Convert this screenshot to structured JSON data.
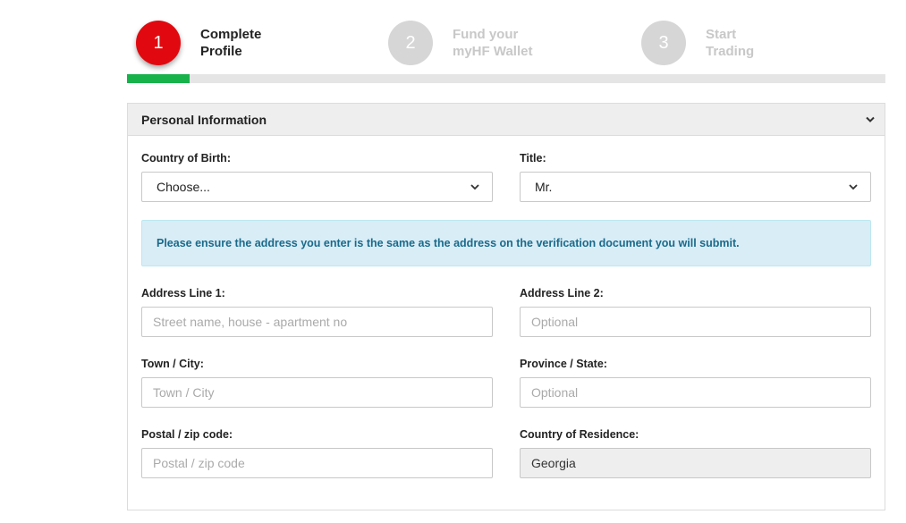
{
  "stepper": {
    "steps": [
      {
        "number": "1",
        "label": "Complete\nProfile",
        "state": "active"
      },
      {
        "number": "2",
        "label": "Fund your\nmyHF Wallet",
        "state": "inactive"
      },
      {
        "number": "3",
        "label": "Start\nTrading",
        "state": "inactive"
      }
    ],
    "progress_fraction": 0.083,
    "colors": {
      "active": "#e1090f",
      "inactive": "#d6d6d6",
      "progress": "#18b24b"
    }
  },
  "panel": {
    "title": "Personal Information",
    "icon": "chevron-down-icon",
    "alert_text": "Please ensure the address you enter is the same as the address on the verification document you will submit.",
    "fields": {
      "country_of_birth": {
        "label": "Country of Birth:",
        "value": "Choose..."
      },
      "title": {
        "label": "Title:",
        "value": "Mr."
      },
      "address_line_1": {
        "label": "Address Line 1:",
        "placeholder": "Street name, house - apartment no"
      },
      "address_line_2": {
        "label": "Address Line 2:",
        "placeholder": "Optional"
      },
      "town_city": {
        "label": "Town / City:",
        "placeholder": "Town / City"
      },
      "province_state": {
        "label": "Province / State:",
        "placeholder": "Optional"
      },
      "postal_code": {
        "label": "Postal / zip code:",
        "placeholder": "Postal / zip code"
      },
      "country_of_residence": {
        "label": "Country of Residence:",
        "value": "Georgia"
      }
    }
  }
}
